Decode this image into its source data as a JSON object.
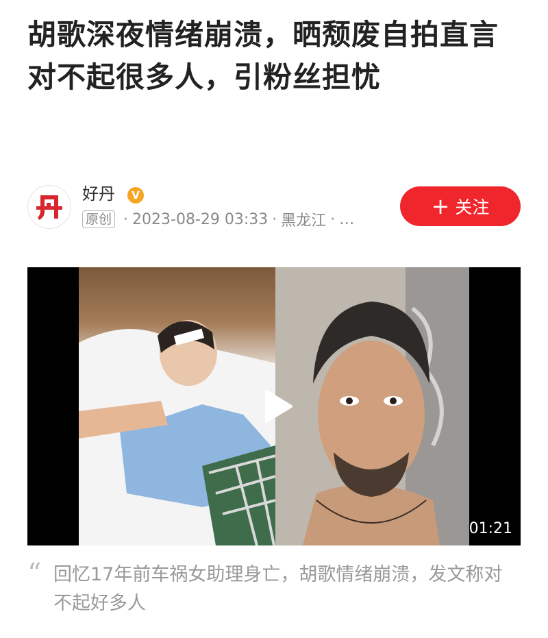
{
  "article": {
    "title": "胡歌深夜情绪崩溃，晒颓废自拍直言对不起很多人，引粉丝担忧"
  },
  "author": {
    "avatar_text": "丹",
    "name": "好丹",
    "verified_mark": "V",
    "original_badge": "原创",
    "date": "2023-08-29 03:33",
    "location": "黑龙江",
    "more": "…",
    "follow_label": "关注",
    "follow_icon": "plus-icon",
    "brand_color": "#f0262d"
  },
  "video": {
    "duration": "01:21",
    "play_icon": "play-icon"
  },
  "caption": {
    "text": "回忆17年前车祸女助理身亡，胡歌情绪崩溃，发文称对不起好多人"
  }
}
